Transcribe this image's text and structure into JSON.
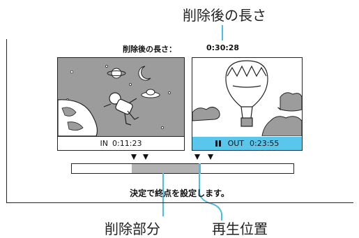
{
  "callouts": {
    "remaining_length": "削除後の長さ",
    "deleted_section": "削除部分",
    "playback_position": "再生位置"
  },
  "osd": {
    "remaining_label": "削除後の長さ：",
    "remaining_time": "0:30:28",
    "in_label": "IN",
    "in_time": "0:11:23",
    "out_label": "OUT",
    "out_time": "0:23:55",
    "pause_icon": "pause-icon",
    "instruction": "決定で終点を設定します。"
  },
  "timeline": {
    "deleted_start_fraction": 0.27,
    "deleted_end_fraction": 0.575,
    "playhead_fraction": 0.575
  },
  "colors": {
    "leader": "#4bbde9",
    "deleted_fill": "#b3b3b3",
    "out_caption_bg": "#5bc6ec",
    "thumb_bg": "#9c9c9c"
  }
}
